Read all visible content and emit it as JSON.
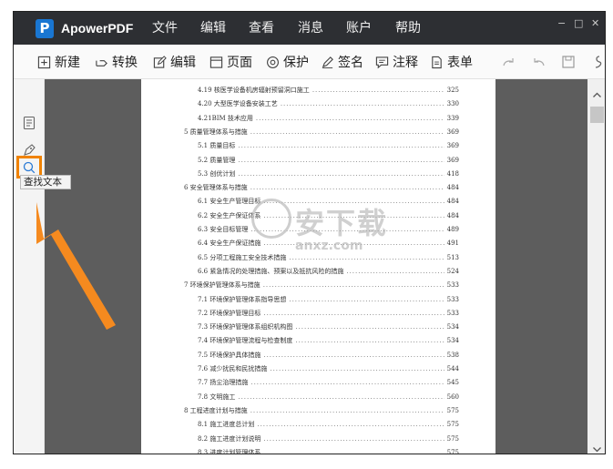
{
  "app": {
    "logo_letter": "P",
    "name": "ApowerPDF",
    "menu": [
      "文件",
      "编辑",
      "查看",
      "消息",
      "账户",
      "帮助"
    ],
    "window_controls": [
      "−",
      "□",
      "✕"
    ]
  },
  "toolbar": {
    "tools": [
      {
        "label": "新建",
        "icon": "new-icon"
      },
      {
        "label": "转换",
        "icon": "convert-icon"
      },
      {
        "label": "编辑",
        "icon": "edit-icon"
      },
      {
        "label": "页面",
        "icon": "page-icon"
      },
      {
        "label": "保护",
        "icon": "protect-icon"
      },
      {
        "label": "签名",
        "icon": "sign-icon"
      },
      {
        "label": "注释",
        "icon": "comment-icon"
      },
      {
        "label": "表单",
        "icon": "form-icon"
      }
    ],
    "right_icons": [
      "redo-icon",
      "undo-icon",
      "save-icon",
      "more-icon"
    ]
  },
  "sidebar": {
    "icons": [
      "thumbnail-icon",
      "bookmark-icon",
      "search-icon"
    ],
    "tooltip": "查找文本",
    "highlight_color": "#f08300"
  },
  "toc": [
    {
      "title": "4.19 核医学设备机房辐射预留洞口施工",
      "page": "325",
      "level": 2
    },
    {
      "title": "4.20 大型医学设备安装工艺",
      "page": "330",
      "level": 2
    },
    {
      "title": "4.21BIM 技术应用",
      "page": "339",
      "level": 2
    },
    {
      "title": "5   质量管理体系与措施",
      "page": "369",
      "level": 1
    },
    {
      "title": "5.1 质量目标",
      "page": "369",
      "level": 2
    },
    {
      "title": "5.2 质量管理",
      "page": "369",
      "level": 2
    },
    {
      "title": "5.3 创优计划",
      "page": "418",
      "level": 2
    },
    {
      "title": "6   安全管理体系与措施",
      "page": "484",
      "level": 1
    },
    {
      "title": "6.1 安全生产管理目标",
      "page": "484",
      "level": 2
    },
    {
      "title": "6.2 安全生产保证体系",
      "page": "484",
      "level": 2
    },
    {
      "title": "6.3 安全目标管理",
      "page": "489",
      "level": 2
    },
    {
      "title": "6.4 安全生产保证措施",
      "page": "491",
      "level": 2
    },
    {
      "title": "6.5 分项工程施工安全技术措施",
      "page": "513",
      "level": 2
    },
    {
      "title": "6.6 紧急情况的处理措施、预案以及抵抗风险的措施",
      "page": "524",
      "level": 2
    },
    {
      "title": "7   环境保护管理体系与措施",
      "page": "533",
      "level": 1
    },
    {
      "title": "7.1 环境保护管理体系指导思想",
      "page": "533",
      "level": 2
    },
    {
      "title": "7.2 环境保护管理目标",
      "page": "533",
      "level": 2
    },
    {
      "title": "7.3 环境保护管理体系组织机构图",
      "page": "534",
      "level": 2
    },
    {
      "title": "7.4 环境保护管理流程与检查制度",
      "page": "534",
      "level": 2
    },
    {
      "title": "7.5 环境保护具体措施",
      "page": "538",
      "level": 2
    },
    {
      "title": "7.6 减少扰民和民扰措施",
      "page": "544",
      "level": 2
    },
    {
      "title": "7.7 扬尘治理措施",
      "page": "545",
      "level": 2
    },
    {
      "title": "7.8 文明施工",
      "page": "560",
      "level": 2
    },
    {
      "title": "8   工程进度计划与措施",
      "page": "575",
      "level": 1
    },
    {
      "title": "8.1 施工进度总计划",
      "page": "575",
      "level": 2
    },
    {
      "title": "8.2 施工进度计划说明",
      "page": "575",
      "level": 2
    },
    {
      "title": "8.3 进度计划管理体系",
      "page": "575",
      "level": 2
    }
  ],
  "watermark": {
    "text": "安下载",
    "domain": "anxz.com"
  },
  "arrow_color": "#f58a1f"
}
